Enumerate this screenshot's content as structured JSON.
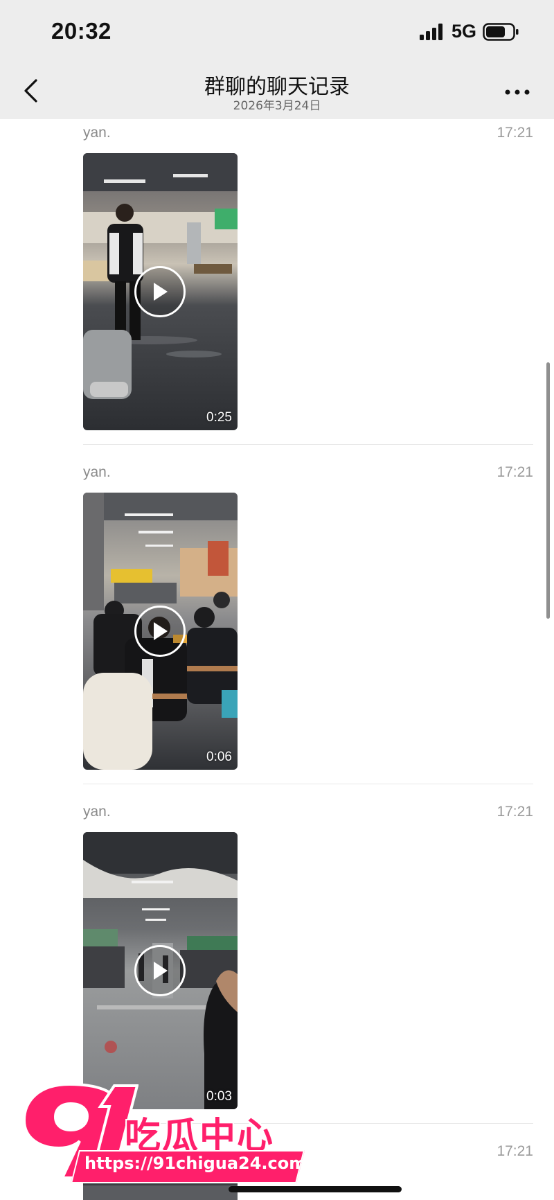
{
  "status_bar": {
    "time": "20:32",
    "network": "5G",
    "signal_icon": "signal-bars-icon",
    "battery_icon": "battery-icon"
  },
  "nav": {
    "back_icon": "chevron-left-icon",
    "title": "群聊的聊天记录",
    "subtitle": "2026年3月24日",
    "more_icon": "ellipsis-icon"
  },
  "messages": [
    {
      "sender": "yan.",
      "time": "17:21",
      "type": "video",
      "duration": "0:25",
      "scene": "canteen-person-walking"
    },
    {
      "sender": "yan.",
      "time": "17:21",
      "type": "video",
      "duration": "0:06",
      "scene": "canteen-crowd-seated"
    },
    {
      "sender": "yan.",
      "time": "17:21",
      "type": "video",
      "duration": "0:03",
      "scene": "canteen-hall-corridor"
    },
    {
      "sender": "",
      "time": "17:21",
      "type": "video",
      "duration": "",
      "scene": "partial"
    }
  ],
  "watermark": {
    "logo": "91",
    "text": "吃瓜中心",
    "url": "https://91chigua24.com"
  },
  "colors": {
    "header_bg": "#ededed",
    "watermark_pink": "#ff1f6b",
    "meta_gray": "#9a9a9a"
  }
}
